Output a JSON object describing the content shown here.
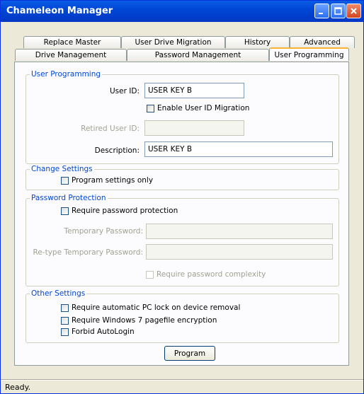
{
  "window": {
    "title": "Chameleon Manager"
  },
  "tabs": {
    "row1": [
      "Replace Master",
      "User Drive Migration",
      "History",
      "Advanced"
    ],
    "row2": [
      "Drive Management",
      "Password Management",
      "User Programming"
    ],
    "active": "User Programming"
  },
  "user_programming": {
    "group_title": "User Programming",
    "user_id_label": "User ID:",
    "user_id_value": "USER KEY B",
    "enable_migration_label": "Enable User ID Migration",
    "retired_user_id_label": "Retired User ID:",
    "retired_user_id_value": "",
    "description_label": "Description:",
    "description_value": "USER KEY B"
  },
  "change_settings": {
    "group_title": "Change Settings",
    "program_settings_only_label": "Program settings only"
  },
  "password_protection": {
    "group_title": "Password Protection",
    "require_label": "Require password protection",
    "temp_password_label": "Temporary Password:",
    "retype_label": "Re-type Temporary Password:",
    "complexity_label": "Require password complexity"
  },
  "other_settings": {
    "group_title": "Other Settings",
    "pc_lock_label": "Require automatic PC lock on device removal",
    "pagefile_label": "Require Windows 7 pagefile encryption",
    "autologin_label": "Forbid AutoLogin"
  },
  "program_button": "Program",
  "status_text": "Ready."
}
